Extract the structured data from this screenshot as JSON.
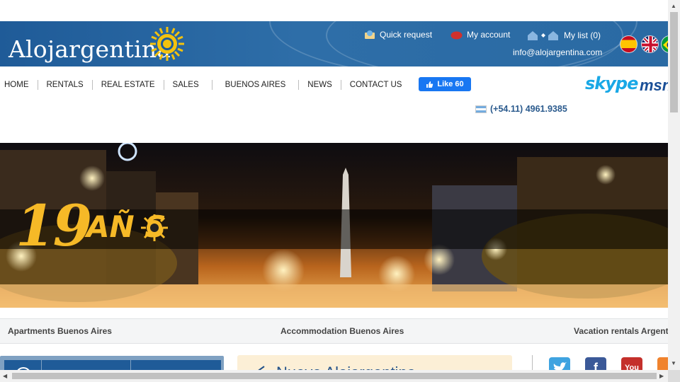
{
  "header": {
    "logo": "Alojargentina",
    "quick_request": "Quick request",
    "my_account": "My account",
    "my_list": "My list (0)",
    "email": "info@alojargentina.com",
    "brand_color": "#2a65a0"
  },
  "flags": [
    "spanish-flag",
    "uk-flag",
    "brazil-flag"
  ],
  "nav": [
    "HOME",
    "RENTALS",
    "REAL ESTATE",
    "SALES",
    "BUENOS AIRES",
    "NEWS",
    "CONTACT US"
  ],
  "facebook": {
    "label": "Like 60"
  },
  "contact": {
    "skype": "skype",
    "msn": "msn",
    "phone": "(+54.11) 4961.9385"
  },
  "banner": {
    "title_number": "19",
    "title_word": "AÑ  S"
  },
  "tabs": [
    "Apartments Buenos Aires",
    "Accommodation Buenos Aires",
    "Vacation rentals Argent"
  ],
  "news": {
    "title": "Nuevo Alojargentina"
  },
  "social": [
    "twitter-icon",
    "facebook-icon",
    "youtube-icon",
    "rss-icon"
  ]
}
